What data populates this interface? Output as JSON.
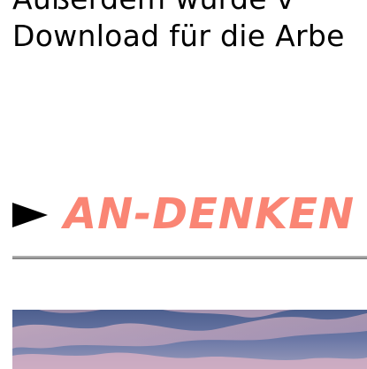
{
  "article": {
    "text_line_1": "Außerdem  wurde  v",
    "text_line_2": "Download für die Arbe"
  },
  "section": {
    "heading": "AN-DENKEN",
    "heading_color": "#fa8574",
    "bullet_icon": "right-pointer-icon"
  },
  "image": {
    "subject": "sky-photo",
    "colors": {
      "sky_dark": "#4c5f8d",
      "sky_light": "#b3a8c3",
      "cloud_pink": "#e9b6c0"
    }
  }
}
